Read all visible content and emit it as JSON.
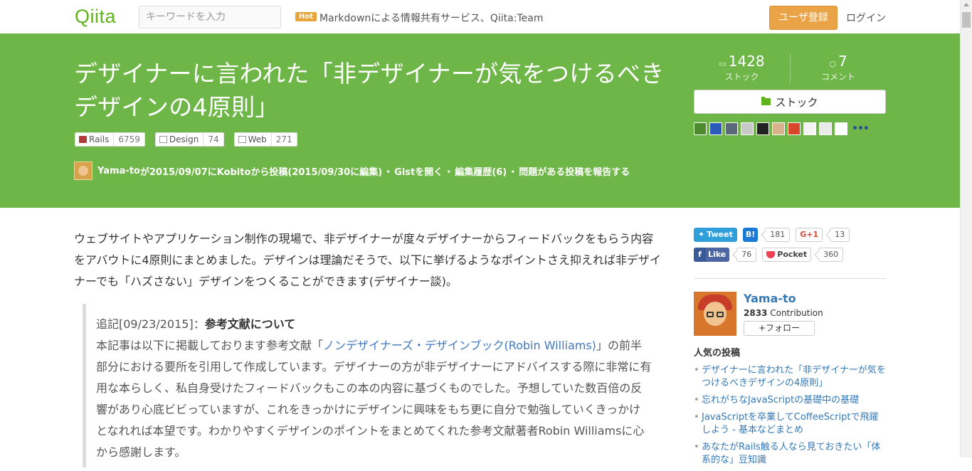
{
  "header": {
    "logo": "Qiita",
    "search_placeholder": "キーワードを入力",
    "hot_badge": "Hot",
    "hot_link": "Markdownによる情報共有サービス、Qiita:Team",
    "signup_label": "ユーザ登録",
    "login_label": "ログイン"
  },
  "article": {
    "title_line1": "デザイナーに言われた「非デザイナーが気をつけるべき",
    "title_line2": "デザインの4原則」",
    "tags": [
      {
        "name": "Rails",
        "count": "6759",
        "icon": "rails-icon"
      },
      {
        "name": "Design",
        "count": "74",
        "icon": "tag-icon"
      },
      {
        "name": "Web",
        "count": "271",
        "icon": "tag-icon"
      }
    ],
    "meta": {
      "author": "Yama-to",
      "posted": "が2015/09/07にKobitoから投稿(2015/09/30に編集)",
      "sep1": "・",
      "gist": "Gistを開く",
      "sep2": "・",
      "history": "編集履歴(6)",
      "sep3": "・",
      "report": "問題がある投稿を報告する"
    },
    "stock_count": "1428",
    "stock_label": "ストック",
    "comment_count": "7",
    "comment_label": "コメント",
    "stock_button": "ストック",
    "more_stockers": "•••"
  },
  "body": {
    "intro": "ウェブサイトやアプリケーション制作の現場で、非デザイナーが度々デザイナーからフィードバックをもらう内容をアバウトに4原則にまとめました。デザインは理論だそうで、以下に挙げるようなポイントさえ抑えれば非デザイナーでも「ハズさない」デザインをつくることができます(デザイナー談)。",
    "quote_head": "追記[09/23/2015]：",
    "quote_head_bold": "参考文献について",
    "quote_pre": "本記事は以下に掲載しております参考文献「",
    "quote_link": "ノンデザイナーズ・デザインブック(Robin Williams)",
    "quote_post": "」の前半部分における要所を引用して作成しています。デザイナーの方が非デザイナーにアドバイスする際に非常に有用な本らしく、私自身受けたフィードバックもこの本の内容に基づくものでした。予想していた数百倍の反響があり心底ビビっていますが、これをきっかけにデザインに興味をもち更に自分で勉強していくきっかけとなれれば本望です。わかりやすくデザインのポイントをまとめてくれた参考文献著者Robin Williamsに心から感謝します。"
  },
  "sidebar": {
    "tweet": "Tweet",
    "hatena": "B!",
    "hatena_count": "181",
    "gplus": "G+1",
    "gplus_count": "13",
    "like": "Like",
    "like_count": "76",
    "pocket": "Pocket",
    "pocket_count": "360",
    "author_name": "Yama-to",
    "contribution_count": "2833",
    "contribution_label": "Contribution",
    "follow_label": "+フォロー",
    "popular_title": "人気の投稿",
    "popular": [
      "デザイナーに言われた「非デザイナーが気をつけるべきデザインの4原則」",
      "忘れがちなJavaScriptの基礎中の基礎",
      "JavaScriptを卒業してCoffeeScriptで飛躍しよう - 基本などまとめ",
      "あなたがRails触る人なら見ておきたい「体系的な」豆知識"
    ]
  },
  "colors": {
    "brand_green": "#6fb648",
    "logo_green": "#5fb41d",
    "signup_orange": "#eaa447",
    "link_blue": "#3478b5"
  }
}
